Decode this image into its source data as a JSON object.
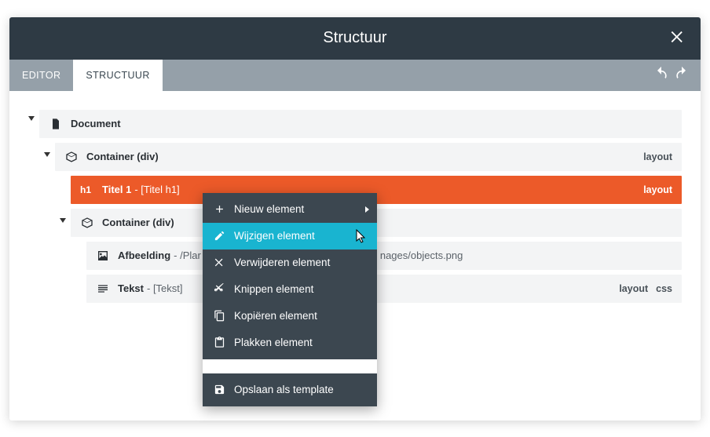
{
  "titlebar": {
    "title": "Structuur"
  },
  "tabs": {
    "editor": "EDITOR",
    "structuur": "STRUCTUUR"
  },
  "tags": {
    "layout": "layout",
    "css": "css"
  },
  "tree": {
    "document": {
      "label": "Document"
    },
    "container1": {
      "label": "Container (div)"
    },
    "titel1": {
      "prefix": "h1",
      "label": "Titel 1",
      "extra": " - [Titel h1]"
    },
    "container2": {
      "label": "Container (div)"
    },
    "afbeelding": {
      "label": "Afbeelding",
      "extra_left": " - /Plar",
      "extra_right": "nages/objects.png"
    },
    "tekst": {
      "label": "Tekst",
      "extra": " - [Tekst]"
    }
  },
  "ctx": {
    "new": "Nieuw element",
    "edit": "Wijzigen element",
    "delete": "Verwijderen element",
    "cut": "Knippen element",
    "copy": "Kopiëren element",
    "paste": "Plakken element",
    "save": "Opslaan als template"
  }
}
